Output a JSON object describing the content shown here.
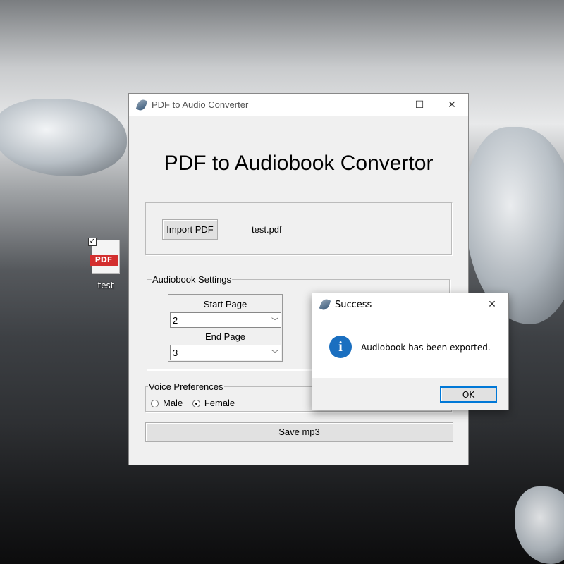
{
  "desktop": {
    "icon_label": "test",
    "icon_badge": "PDF"
  },
  "window": {
    "title": "PDF to Audio Converter",
    "minimize": "—",
    "maximize": "☐",
    "close": "✕",
    "heading": "PDF to Audiobook Convertor",
    "import_button": "Import PDF",
    "file_name": "test.pdf",
    "settings_legend": "Audiobook Settings",
    "start_label": "Start Page",
    "start_value": "2",
    "end_label": "End Page",
    "end_value": "3",
    "voice_legend": "Voice Preferences",
    "voice_options": [
      "Male",
      "Female"
    ],
    "voice_selected": "Female",
    "save_button": "Save mp3"
  },
  "dialog": {
    "title": "Success",
    "close": "✕",
    "icon": "i",
    "message": "Audiobook has been exported.",
    "ok": "OK"
  }
}
